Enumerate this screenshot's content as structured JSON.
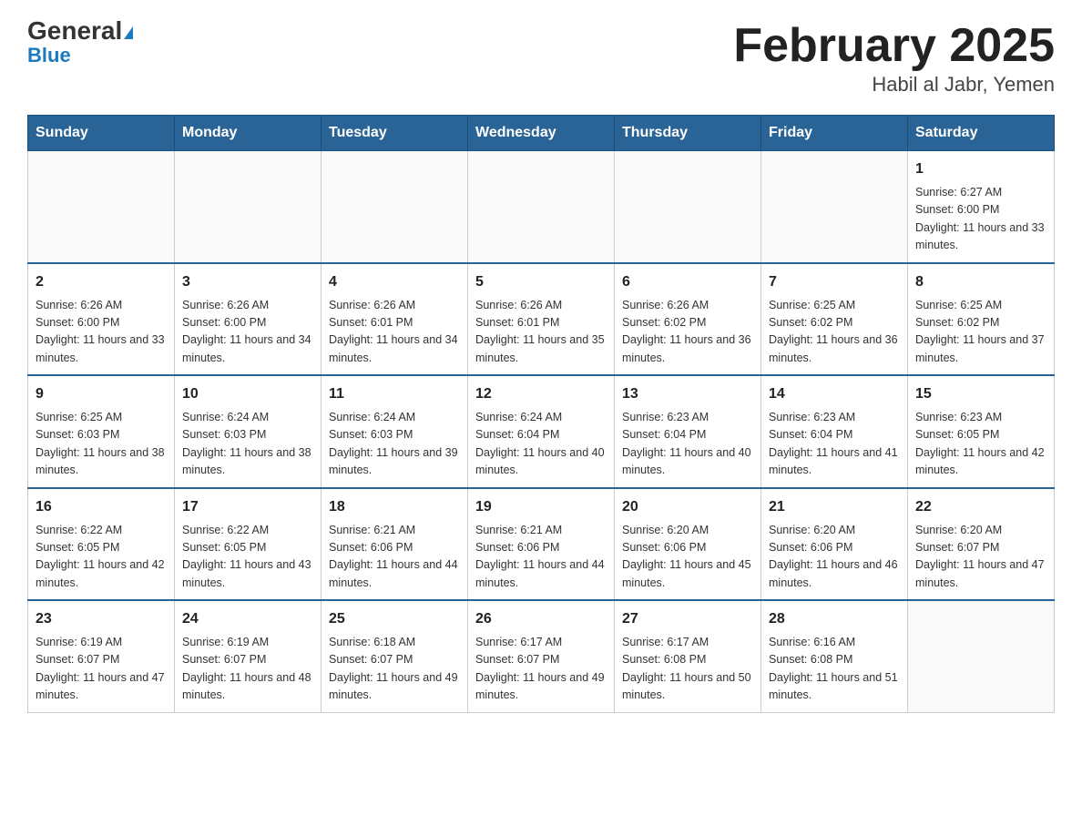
{
  "header": {
    "logo_general": "General",
    "logo_blue": "Blue",
    "title": "February 2025",
    "subtitle": "Habil al Jabr, Yemen"
  },
  "days_of_week": [
    "Sunday",
    "Monday",
    "Tuesday",
    "Wednesday",
    "Thursday",
    "Friday",
    "Saturday"
  ],
  "weeks": [
    {
      "days": [
        {
          "num": "",
          "sunrise": "",
          "sunset": "",
          "daylight": "",
          "empty": true
        },
        {
          "num": "",
          "sunrise": "",
          "sunset": "",
          "daylight": "",
          "empty": true
        },
        {
          "num": "",
          "sunrise": "",
          "sunset": "",
          "daylight": "",
          "empty": true
        },
        {
          "num": "",
          "sunrise": "",
          "sunset": "",
          "daylight": "",
          "empty": true
        },
        {
          "num": "",
          "sunrise": "",
          "sunset": "",
          "daylight": "",
          "empty": true
        },
        {
          "num": "",
          "sunrise": "",
          "sunset": "",
          "daylight": "",
          "empty": true
        },
        {
          "num": "1",
          "sunrise": "Sunrise: 6:27 AM",
          "sunset": "Sunset: 6:00 PM",
          "daylight": "Daylight: 11 hours and 33 minutes.",
          "empty": false
        }
      ]
    },
    {
      "days": [
        {
          "num": "2",
          "sunrise": "Sunrise: 6:26 AM",
          "sunset": "Sunset: 6:00 PM",
          "daylight": "Daylight: 11 hours and 33 minutes.",
          "empty": false
        },
        {
          "num": "3",
          "sunrise": "Sunrise: 6:26 AM",
          "sunset": "Sunset: 6:00 PM",
          "daylight": "Daylight: 11 hours and 34 minutes.",
          "empty": false
        },
        {
          "num": "4",
          "sunrise": "Sunrise: 6:26 AM",
          "sunset": "Sunset: 6:01 PM",
          "daylight": "Daylight: 11 hours and 34 minutes.",
          "empty": false
        },
        {
          "num": "5",
          "sunrise": "Sunrise: 6:26 AM",
          "sunset": "Sunset: 6:01 PM",
          "daylight": "Daylight: 11 hours and 35 minutes.",
          "empty": false
        },
        {
          "num": "6",
          "sunrise": "Sunrise: 6:26 AM",
          "sunset": "Sunset: 6:02 PM",
          "daylight": "Daylight: 11 hours and 36 minutes.",
          "empty": false
        },
        {
          "num": "7",
          "sunrise": "Sunrise: 6:25 AM",
          "sunset": "Sunset: 6:02 PM",
          "daylight": "Daylight: 11 hours and 36 minutes.",
          "empty": false
        },
        {
          "num": "8",
          "sunrise": "Sunrise: 6:25 AM",
          "sunset": "Sunset: 6:02 PM",
          "daylight": "Daylight: 11 hours and 37 minutes.",
          "empty": false
        }
      ]
    },
    {
      "days": [
        {
          "num": "9",
          "sunrise": "Sunrise: 6:25 AM",
          "sunset": "Sunset: 6:03 PM",
          "daylight": "Daylight: 11 hours and 38 minutes.",
          "empty": false
        },
        {
          "num": "10",
          "sunrise": "Sunrise: 6:24 AM",
          "sunset": "Sunset: 6:03 PM",
          "daylight": "Daylight: 11 hours and 38 minutes.",
          "empty": false
        },
        {
          "num": "11",
          "sunrise": "Sunrise: 6:24 AM",
          "sunset": "Sunset: 6:03 PM",
          "daylight": "Daylight: 11 hours and 39 minutes.",
          "empty": false
        },
        {
          "num": "12",
          "sunrise": "Sunrise: 6:24 AM",
          "sunset": "Sunset: 6:04 PM",
          "daylight": "Daylight: 11 hours and 40 minutes.",
          "empty": false
        },
        {
          "num": "13",
          "sunrise": "Sunrise: 6:23 AM",
          "sunset": "Sunset: 6:04 PM",
          "daylight": "Daylight: 11 hours and 40 minutes.",
          "empty": false
        },
        {
          "num": "14",
          "sunrise": "Sunrise: 6:23 AM",
          "sunset": "Sunset: 6:04 PM",
          "daylight": "Daylight: 11 hours and 41 minutes.",
          "empty": false
        },
        {
          "num": "15",
          "sunrise": "Sunrise: 6:23 AM",
          "sunset": "Sunset: 6:05 PM",
          "daylight": "Daylight: 11 hours and 42 minutes.",
          "empty": false
        }
      ]
    },
    {
      "days": [
        {
          "num": "16",
          "sunrise": "Sunrise: 6:22 AM",
          "sunset": "Sunset: 6:05 PM",
          "daylight": "Daylight: 11 hours and 42 minutes.",
          "empty": false
        },
        {
          "num": "17",
          "sunrise": "Sunrise: 6:22 AM",
          "sunset": "Sunset: 6:05 PM",
          "daylight": "Daylight: 11 hours and 43 minutes.",
          "empty": false
        },
        {
          "num": "18",
          "sunrise": "Sunrise: 6:21 AM",
          "sunset": "Sunset: 6:06 PM",
          "daylight": "Daylight: 11 hours and 44 minutes.",
          "empty": false
        },
        {
          "num": "19",
          "sunrise": "Sunrise: 6:21 AM",
          "sunset": "Sunset: 6:06 PM",
          "daylight": "Daylight: 11 hours and 44 minutes.",
          "empty": false
        },
        {
          "num": "20",
          "sunrise": "Sunrise: 6:20 AM",
          "sunset": "Sunset: 6:06 PM",
          "daylight": "Daylight: 11 hours and 45 minutes.",
          "empty": false
        },
        {
          "num": "21",
          "sunrise": "Sunrise: 6:20 AM",
          "sunset": "Sunset: 6:06 PM",
          "daylight": "Daylight: 11 hours and 46 minutes.",
          "empty": false
        },
        {
          "num": "22",
          "sunrise": "Sunrise: 6:20 AM",
          "sunset": "Sunset: 6:07 PM",
          "daylight": "Daylight: 11 hours and 47 minutes.",
          "empty": false
        }
      ]
    },
    {
      "days": [
        {
          "num": "23",
          "sunrise": "Sunrise: 6:19 AM",
          "sunset": "Sunset: 6:07 PM",
          "daylight": "Daylight: 11 hours and 47 minutes.",
          "empty": false
        },
        {
          "num": "24",
          "sunrise": "Sunrise: 6:19 AM",
          "sunset": "Sunset: 6:07 PM",
          "daylight": "Daylight: 11 hours and 48 minutes.",
          "empty": false
        },
        {
          "num": "25",
          "sunrise": "Sunrise: 6:18 AM",
          "sunset": "Sunset: 6:07 PM",
          "daylight": "Daylight: 11 hours and 49 minutes.",
          "empty": false
        },
        {
          "num": "26",
          "sunrise": "Sunrise: 6:17 AM",
          "sunset": "Sunset: 6:07 PM",
          "daylight": "Daylight: 11 hours and 49 minutes.",
          "empty": false
        },
        {
          "num": "27",
          "sunrise": "Sunrise: 6:17 AM",
          "sunset": "Sunset: 6:08 PM",
          "daylight": "Daylight: 11 hours and 50 minutes.",
          "empty": false
        },
        {
          "num": "28",
          "sunrise": "Sunrise: 6:16 AM",
          "sunset": "Sunset: 6:08 PM",
          "daylight": "Daylight: 11 hours and 51 minutes.",
          "empty": false
        },
        {
          "num": "",
          "sunrise": "",
          "sunset": "",
          "daylight": "",
          "empty": true
        }
      ]
    }
  ]
}
